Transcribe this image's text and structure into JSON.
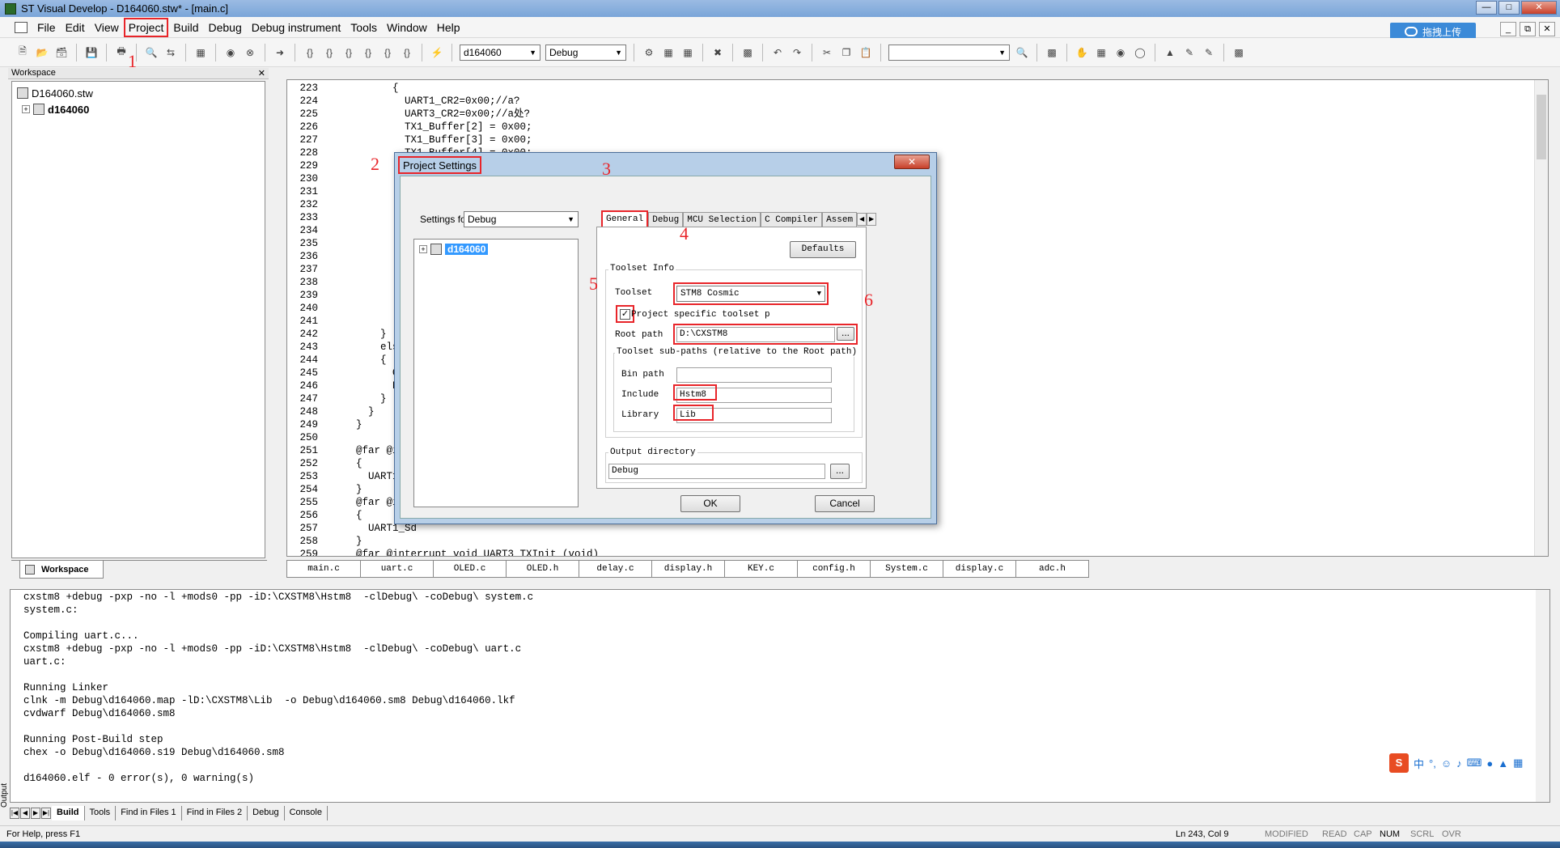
{
  "window": {
    "title": "ST Visual Develop - D164060.stw* - [main.c]",
    "upload_label": "拖拽上传"
  },
  "menu": [
    "File",
    "Edit",
    "View",
    "Project",
    "Build",
    "Debug",
    "Debug instrument",
    "Tools",
    "Window",
    "Help"
  ],
  "toolbar": {
    "target_combo": "d164060",
    "config_combo": "Debug"
  },
  "workspace": {
    "label": "Workspace",
    "root": "D164060.stw",
    "project": "d164060",
    "tab": "Workspace"
  },
  "editor": {
    "lines": [
      {
        "n": "223",
        "code": "        {"
      },
      {
        "n": "224",
        "code": "          UART1_CR2=0x00;//a?"
      },
      {
        "n": "225",
        "code": "          UART3_CR2=0x00;//a处?"
      },
      {
        "n": "226",
        "code": "          TX1_Buffer[2] = 0x00;"
      },
      {
        "n": "227",
        "code": "          TX1_Buffer[3] = 0x00;"
      },
      {
        "n": "228",
        "code": "          TX1_Buffer[4] = 0x00;"
      },
      {
        "n": "229",
        "code": ""
      },
      {
        "n": "230",
        "code": ""
      },
      {
        "n": "231",
        "code": ""
      },
      {
        "n": "232",
        "code": ""
      },
      {
        "n": "233",
        "code": ""
      },
      {
        "n": "234",
        "code": ""
      },
      {
        "n": "235",
        "code": ""
      },
      {
        "n": "236",
        "code": ""
      },
      {
        "n": "237",
        "code": ""
      },
      {
        "n": "238",
        "code": ""
      },
      {
        "n": "239",
        "code": ""
      },
      {
        "n": "240",
        "code": ""
      },
      {
        "n": "241",
        "code": ""
      },
      {
        "n": "242",
        "code": "      }"
      },
      {
        "n": "243",
        "code": "      else"
      },
      {
        "n": "244",
        "code": "      {"
      },
      {
        "n": "245",
        "code": "        OLE"
      },
      {
        "n": "246",
        "code": "        Pow"
      },
      {
        "n": "247",
        "code": "      }"
      },
      {
        "n": "248",
        "code": "    }"
      },
      {
        "n": "249",
        "code": "  }"
      },
      {
        "n": "250",
        "code": ""
      },
      {
        "n": "251",
        "code": "  @far @int"
      },
      {
        "n": "252",
        "code": "  {"
      },
      {
        "n": "253",
        "code": "    UART1_S"
      },
      {
        "n": "254",
        "code": "  }"
      },
      {
        "n": "255",
        "code": "  @far @int"
      },
      {
        "n": "256",
        "code": "  {"
      },
      {
        "n": "257",
        "code": "    UART1_Sd"
      },
      {
        "n": "258",
        "code": "  }"
      },
      {
        "n": "259",
        "code": "  @far @interrupt void UART3_TXInit (void)"
      }
    ],
    "tabs": [
      "main.c",
      "uart.c",
      "OLED.c",
      "OLED.h",
      "delay.c",
      "display.h",
      "KEY.c",
      "config.h",
      "System.c",
      "display.c",
      "adc.h"
    ]
  },
  "output": {
    "lines": [
      "cxstm8 +debug -pxp -no -l +mods0 -pp -iD:\\CXSTM8\\Hstm8  -clDebug\\ -coDebug\\ system.c",
      "system.c:",
      "",
      "Compiling uart.c...",
      "cxstm8 +debug -pxp -no -l +mods0 -pp -iD:\\CXSTM8\\Hstm8  -clDebug\\ -coDebug\\ uart.c",
      "uart.c:",
      "",
      "Running Linker",
      "clnk -m Debug\\d164060.map -lD:\\CXSTM8\\Lib  -o Debug\\d164060.sm8 Debug\\d164060.lkf",
      "cvdwarf Debug\\d164060.sm8",
      "",
      "Running Post-Build step",
      "chex -o Debug\\d164060.s19 Debug\\d164060.sm8",
      "",
      "d164060.elf - 0 error(s), 0 warning(s)"
    ],
    "side_label": "Output",
    "tabs": [
      "Build",
      "Tools",
      "Find in Files 1",
      "Find in Files 2",
      "Debug",
      "Console"
    ]
  },
  "status": {
    "help": "For Help, press F1",
    "position": "Ln 243, Col 9",
    "indicators": [
      "MODIFIED",
      "READ",
      "CAP",
      "NUM",
      "SCRL",
      "OVR"
    ]
  },
  "dialog": {
    "title": "Project Settings",
    "settings_for_label": "Settings for:",
    "settings_for_value": "Debug",
    "tree_item": "d164060",
    "tabs": [
      "General",
      "Debug",
      "MCU Selection",
      "C Compiler",
      "Assem"
    ],
    "defaults": "Defaults",
    "toolset_info": "Toolset Info",
    "toolset_label": "Toolset",
    "toolset_value": "STM8 Cosmic",
    "project_specific": "Project specific toolset p",
    "root_path_label": "Root path",
    "root_path_value": "D:\\CXSTM8",
    "browse": "...",
    "subpaths_title": "Toolset sub-paths (relative to the Root path)",
    "bin_label": "Bin path",
    "bin_value": "",
    "include_label": "Include",
    "include_value": "Hstm8",
    "library_label": "Library",
    "library_value": "Lib",
    "output_dir_label": "Output directory",
    "output_dir_value": "Debug",
    "ok": "OK",
    "cancel": "Cancel"
  },
  "annotations": [
    "1",
    "2",
    "3",
    "4",
    "5",
    "6"
  ],
  "ime": {
    "chars": [
      "中",
      "°,"
    ]
  }
}
